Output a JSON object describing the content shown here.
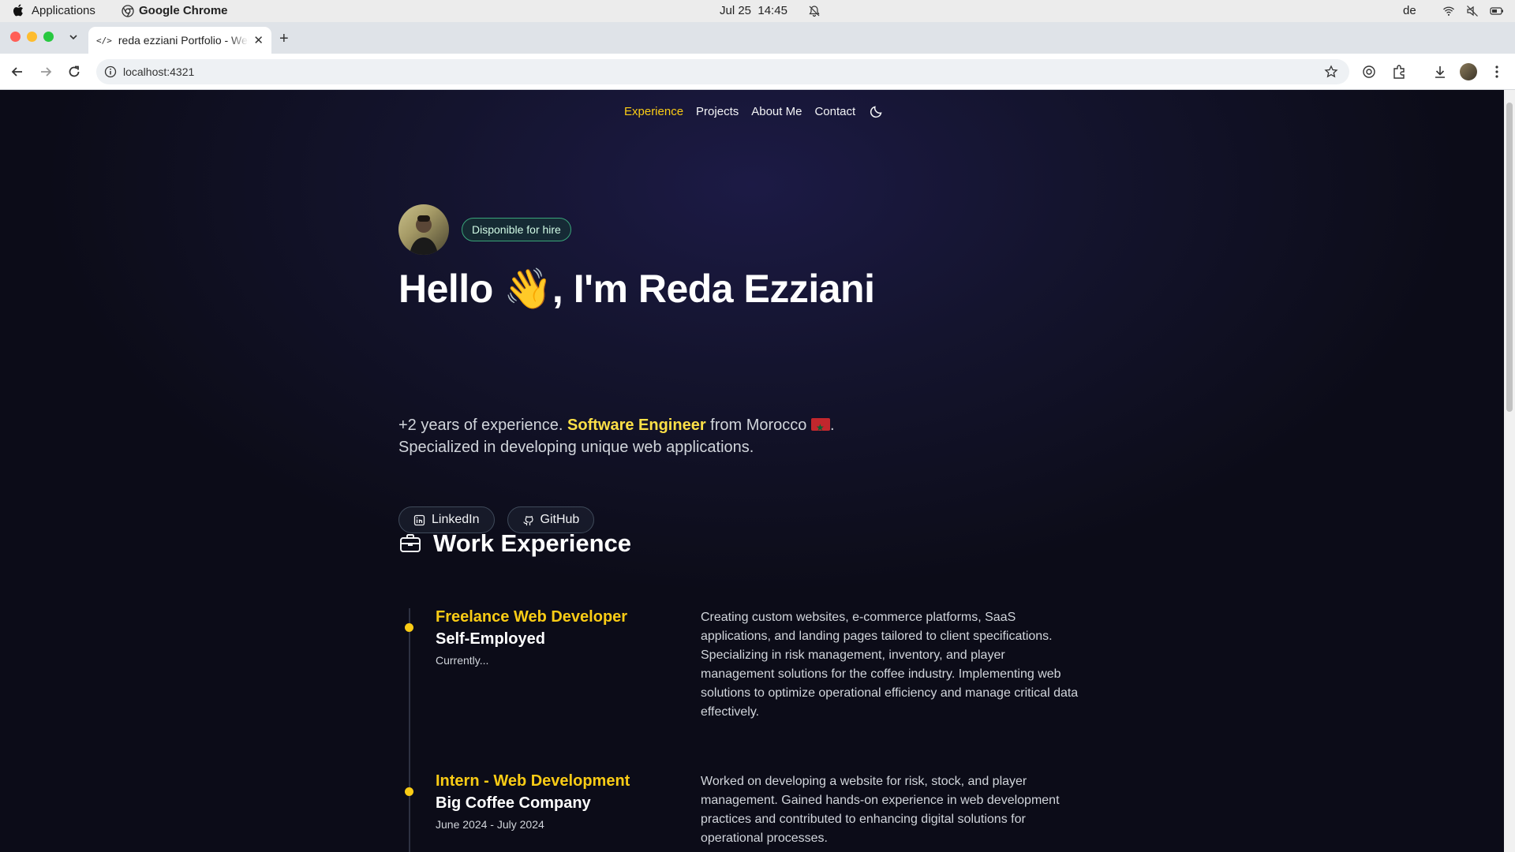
{
  "menubar": {
    "app_menu": "Applications",
    "browser_name": "Google Chrome",
    "date": "Jul 25",
    "time": "14:45",
    "input_language": "de"
  },
  "browser": {
    "tab_title": "reda ezziani Portfolio - Web",
    "url": "localhost:4321"
  },
  "site_nav": {
    "items": [
      "Experience",
      "Projects",
      "About Me",
      "Contact"
    ],
    "active": "Experience"
  },
  "hero": {
    "availability_badge": "Disponible for hire",
    "greeting_prefix": "Hello",
    "greeting_emoji": "👋",
    "greeting_suffix": ", I'm Reda Ezziani",
    "intro_part1": "+2 years of experience. ",
    "intro_highlight": "Software Engineer",
    "intro_part2": " from Morocco",
    "intro_part3": ".",
    "intro_line2": "Specialized in developing unique web applications.",
    "links": [
      "LinkedIn",
      "GitHub"
    ]
  },
  "work_experience": {
    "title": "Work Experience",
    "jobs": [
      {
        "role": "Freelance Web Developer",
        "company": "Self-Employed",
        "date": "Currently...",
        "description": "Creating custom websites, e-commerce platforms, SaaS applications, and landing pages tailored to client specifications. Specializing in risk management, inventory, and player management solutions for the coffee industry. Implementing web solutions to optimize operational efficiency and manage critical data effectively."
      },
      {
        "role": "Intern - Web Development",
        "company": "Big Coffee Company",
        "date": "June 2024 - July 2024",
        "description": "Worked on developing a website for risk, stock, and player management. Gained hands-on experience in web development practices and contributed to enhancing digital solutions for operational processes."
      }
    ]
  },
  "colors": {
    "accent": "#facc15",
    "background": "#0f0f1e",
    "badge_border": "#3aa57a"
  }
}
